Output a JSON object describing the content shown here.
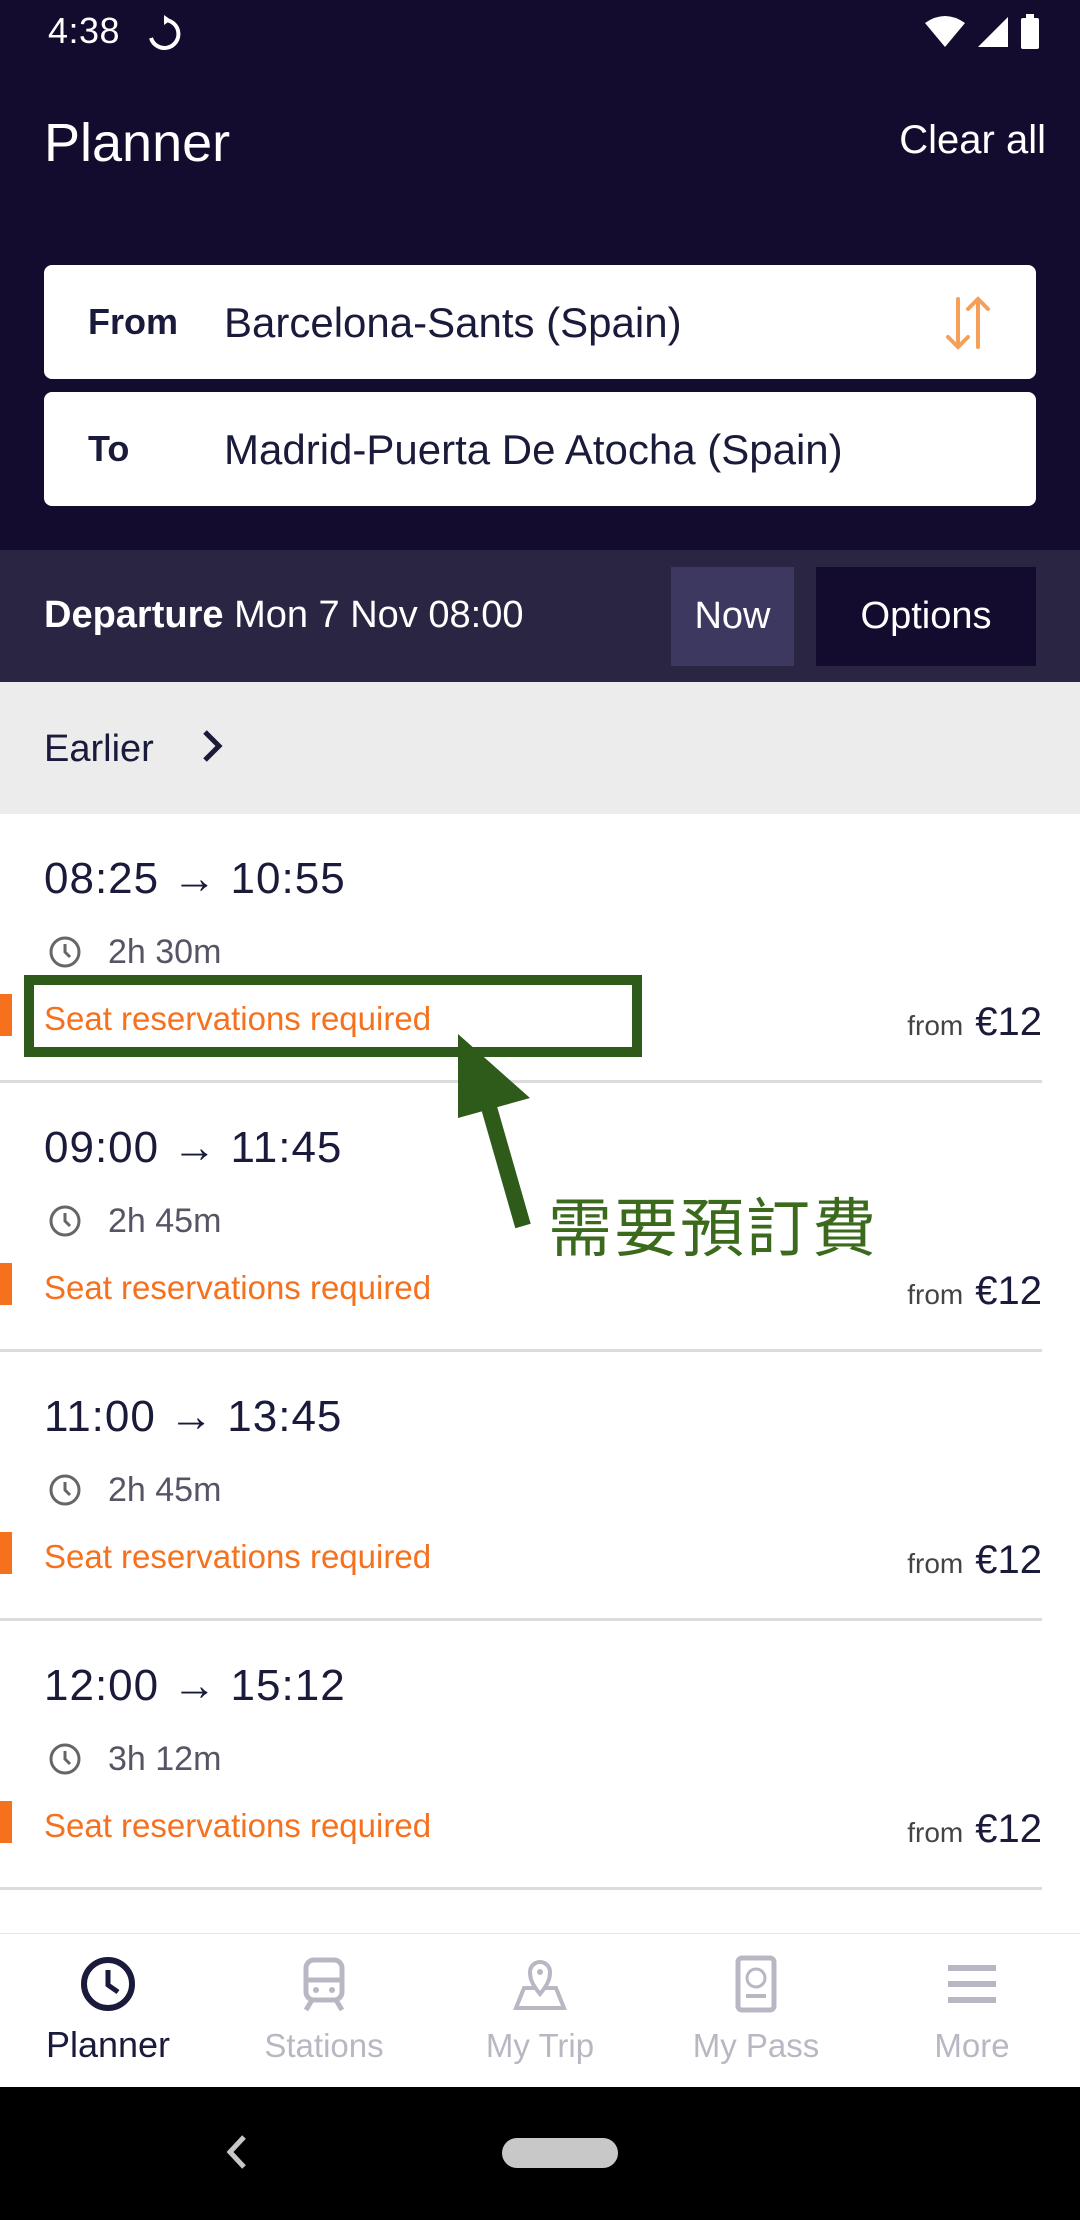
{
  "status_bar": {
    "time": "4:38"
  },
  "header": {
    "title": "Planner",
    "clear_all": "Clear all"
  },
  "search": {
    "from_label": "From",
    "from_value": "Barcelona-Sants (Spain)",
    "to_label": "To",
    "to_value": "Madrid-Puerta De Atocha (Spain)"
  },
  "departure": {
    "label": "Departure",
    "value": "Mon 7 Nov 08:00",
    "now_label": "Now",
    "options_label": "Options"
  },
  "earlier_label": "Earlier",
  "trips": [
    {
      "times": "08:25 → 10:55",
      "duration": "2h 30m",
      "note": "Seat reservations required",
      "from_word": "from",
      "price": "€12"
    },
    {
      "times": "09:00 → 11:45",
      "duration": "2h 45m",
      "note": "Seat reservations required",
      "from_word": "from",
      "price": "€12"
    },
    {
      "times": "11:00 → 13:45",
      "duration": "2h 45m",
      "note": "Seat reservations required",
      "from_word": "from",
      "price": "€12"
    },
    {
      "times": "12:00 → 15:12",
      "duration": "3h 12m",
      "note": "Seat reservations required",
      "from_word": "from",
      "price": "€12"
    }
  ],
  "annotation": {
    "text": "需要預訂費",
    "color": "#2e5a1a"
  },
  "bottom_nav": [
    {
      "label": "Planner",
      "icon": "clock-icon",
      "active": true
    },
    {
      "label": "Stations",
      "icon": "train-icon",
      "active": false
    },
    {
      "label": "My Trip",
      "icon": "map-pin-icon",
      "active": false
    },
    {
      "label": "My Pass",
      "icon": "pass-icon",
      "active": false
    },
    {
      "label": "More",
      "icon": "menu-icon",
      "active": false
    }
  ],
  "colors": {
    "header_bg": "#140c2e",
    "departure_bg": "#2a2542",
    "accent_orange": "#f5711e",
    "text_dark": "#1a1a3a"
  }
}
